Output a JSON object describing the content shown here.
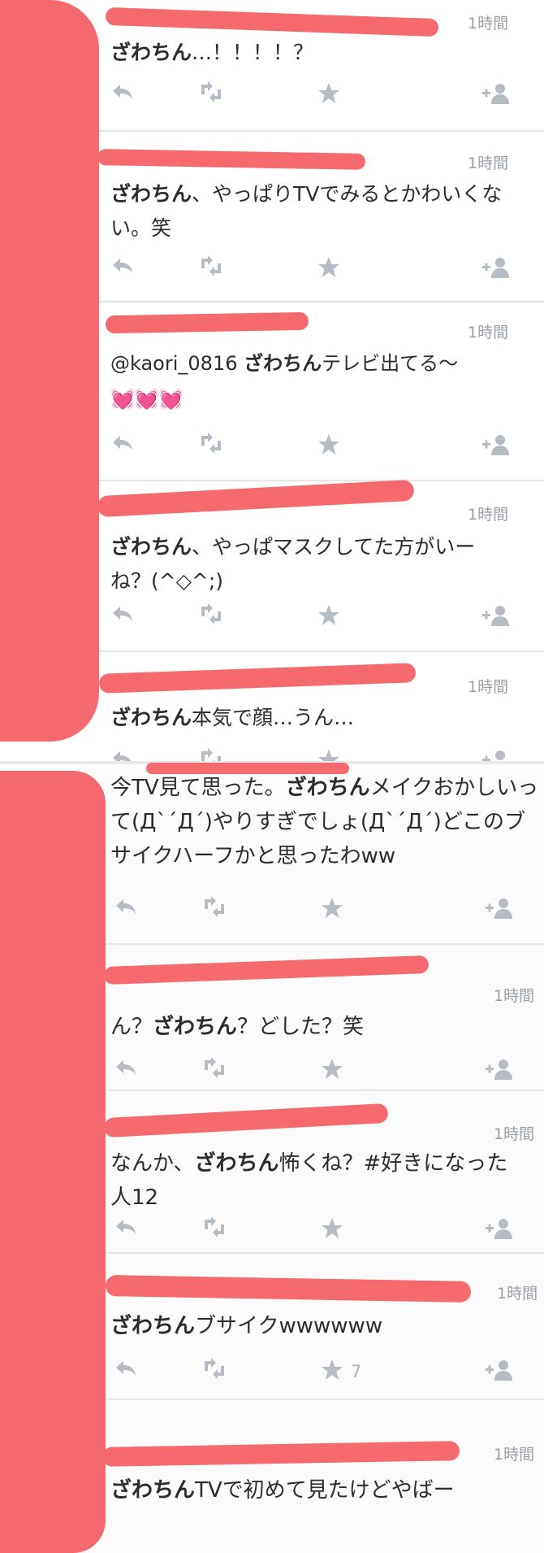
{
  "ui": {
    "retweet_glyph": "⇄",
    "follow_glyph": "+"
  },
  "tweets_top": [
    {
      "time": "1時間",
      "name_bold": "ざわちん",
      "text": "…！！！！？"
    },
    {
      "time": "1時間",
      "name_bold": "ざわちん",
      "text": "、やっぱりTVでみるとかわいくない。笑"
    },
    {
      "time": "1時間",
      "prefix": "@kaori_0816 ",
      "name_bold": "ざわちん",
      "text": "テレビ出てる〜",
      "emoji": "💓💓💓"
    },
    {
      "time": "1時間",
      "name_bold": "ざわちん",
      "text": "、やっぱマスクしてた方がいーね？(^◇^;)"
    },
    {
      "time": "1時間",
      "name_bold": "ざわちん",
      "text": "本気で顔…うん…"
    }
  ],
  "tweets_bottom": [
    {
      "prefix": "今TV見て思った。",
      "name_bold": "ざわちん",
      "text": "メイクおかしいって(ДˋˊДˊ)やりすぎでしょ(ДˋˊДˊ)どこのブサイクハーフかと思ったわww",
      "time": ""
    },
    {
      "time": "1時間",
      "prefix": "ん？",
      "name_bold": "ざわちん",
      "text": "？どした？笑"
    },
    {
      "time": "1時間",
      "prefix": "なんか、",
      "name_bold": "ざわちん",
      "text": "怖くね？#好きになった人12"
    },
    {
      "time": "1時間",
      "name_bold": "ざわちん",
      "text": "ブサイクwwwwww",
      "fav_count": "7"
    },
    {
      "time": "1時間",
      "name_bold": "ざわちん",
      "text": "TVで初めて見たけどやばー"
    }
  ],
  "colors": {
    "redaction": "#f56a6e",
    "icon": "#b5bcc4",
    "time": "#9aa0a6"
  }
}
